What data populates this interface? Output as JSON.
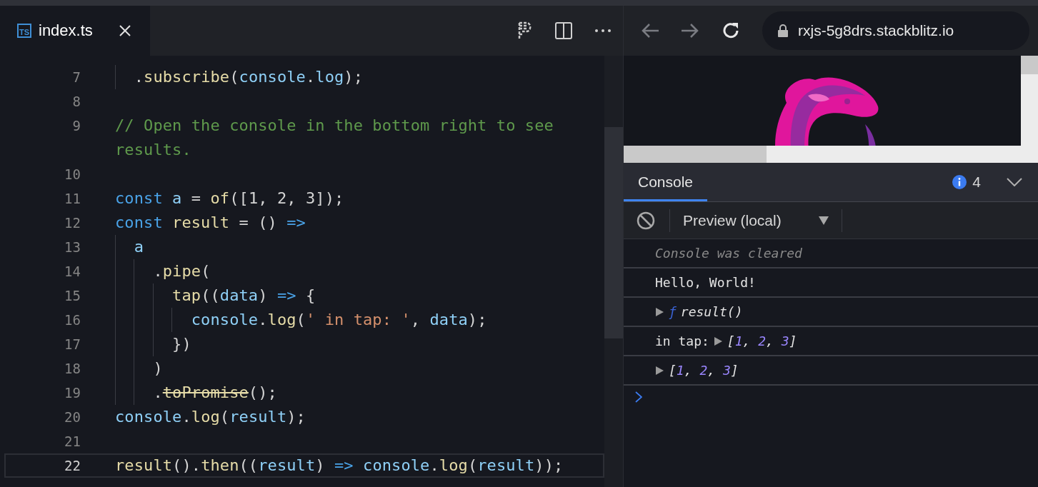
{
  "editor": {
    "tabs": [
      {
        "file_icon": "TS",
        "label": "index.ts",
        "selected": true
      }
    ],
    "lines": [
      {
        "number": "7",
        "current": false,
        "tokens": [
          {
            "kind": "plain",
            "text": "  ."
          },
          {
            "kind": "fn",
            "text": "subscribe"
          },
          {
            "kind": "plain",
            "text": "("
          },
          {
            "kind": "var",
            "text": "console"
          },
          {
            "kind": "plain",
            "text": "."
          },
          {
            "kind": "var",
            "text": "log"
          },
          {
            "kind": "plain",
            "text": ");"
          }
        ]
      },
      {
        "number": "8",
        "current": false
      },
      {
        "number": "9",
        "current": false,
        "tokens": [
          {
            "kind": "comment",
            "text": "// Open the console in the bottom right to see results."
          }
        ]
      },
      {
        "number": "10",
        "current": false
      },
      {
        "number": "11",
        "current": false,
        "tokens": [
          {
            "kind": "keyword",
            "text": "const "
          },
          {
            "kind": "var",
            "text": "a"
          },
          {
            "kind": "plain",
            "text": " = "
          },
          {
            "kind": "fn",
            "text": "of"
          },
          {
            "kind": "plain",
            "text": "([1, 2, 3]);"
          }
        ]
      },
      {
        "number": "12",
        "current": false,
        "tokens": [
          {
            "kind": "keyword",
            "text": "const "
          },
          {
            "kind": "fn",
            "text": "result"
          },
          {
            "kind": "plain",
            "text": " = () "
          },
          {
            "kind": "keyword",
            "text": "=>"
          }
        ]
      },
      {
        "number": "13",
        "current": false,
        "tokens": [
          {
            "kind": "var",
            "text": "  a"
          }
        ]
      },
      {
        "number": "14",
        "current": false,
        "tokens": [
          {
            "kind": "plain",
            "text": "    ."
          },
          {
            "kind": "fn",
            "text": "pipe"
          },
          {
            "kind": "plain",
            "text": "("
          }
        ]
      },
      {
        "number": "15",
        "current": false,
        "tokens": [
          {
            "kind": "fn",
            "text": "      tap"
          },
          {
            "kind": "plain",
            "text": "(("
          },
          {
            "kind": "var",
            "text": "data"
          },
          {
            "kind": "plain",
            "text": ") "
          },
          {
            "kind": "keyword",
            "text": "=>"
          },
          {
            "kind": "plain",
            "text": " {"
          }
        ]
      },
      {
        "number": "16",
        "current": false,
        "tokens": [
          {
            "kind": "var",
            "text": "        console"
          },
          {
            "kind": "plain",
            "text": "."
          },
          {
            "kind": "fn",
            "text": "log"
          },
          {
            "kind": "plain",
            "text": "("
          },
          {
            "kind": "string",
            "text": "' in tap: '"
          },
          {
            "kind": "plain",
            "text": ", "
          },
          {
            "kind": "var",
            "text": "data"
          },
          {
            "kind": "plain",
            "text": ");"
          }
        ]
      },
      {
        "number": "17",
        "current": false,
        "tokens": [
          {
            "kind": "plain",
            "text": "      })"
          }
        ]
      },
      {
        "number": "18",
        "current": false,
        "tokens": [
          {
            "kind": "plain",
            "text": "    )"
          }
        ]
      },
      {
        "number": "19",
        "current": false,
        "tokens": [
          {
            "kind": "plain",
            "text": "    ."
          },
          {
            "kind": "deprecated",
            "text": "toPromise"
          },
          {
            "kind": "plain",
            "text": "();"
          }
        ]
      },
      {
        "number": "20",
        "current": false,
        "tokens": [
          {
            "kind": "var",
            "text": "console"
          },
          {
            "kind": "plain",
            "text": "."
          },
          {
            "kind": "fn",
            "text": "log"
          },
          {
            "kind": "plain",
            "text": "("
          },
          {
            "kind": "var",
            "text": "result"
          },
          {
            "kind": "plain",
            "text": ");"
          }
        ]
      },
      {
        "number": "21",
        "current": false
      },
      {
        "number": "22",
        "current": true,
        "tokens": [
          {
            "kind": "fn",
            "text": "result"
          },
          {
            "kind": "plain",
            "text": "()."
          },
          {
            "kind": "fn",
            "text": "then"
          },
          {
            "kind": "plain",
            "text": "(("
          },
          {
            "kind": "var",
            "text": "result"
          },
          {
            "kind": "plain",
            "text": ") "
          },
          {
            "kind": "keyword",
            "text": "=> "
          },
          {
            "kind": "var",
            "text": "console"
          },
          {
            "kind": "plain",
            "text": "."
          },
          {
            "kind": "fn",
            "text": "log"
          },
          {
            "kind": "plain",
            "text": "("
          },
          {
            "kind": "var",
            "text": "result"
          },
          {
            "kind": "plain",
            "text": "));"
          }
        ]
      }
    ]
  },
  "browser": {
    "url": "rxjs-5g8drs.stackblitz.io"
  },
  "console": {
    "tabs": [
      {
        "label": "Console",
        "selected": true
      }
    ],
    "info_count": "4",
    "context": "Preview (local)",
    "messages": [
      {
        "kind": "cleared",
        "text": "Console was cleared"
      },
      {
        "kind": "text",
        "text": "Hello, World!"
      },
      {
        "kind": "function",
        "prefix": "ƒ",
        "text": "result()"
      },
      {
        "kind": "array",
        "label": "in tap:",
        "value": [
          {
            "kind": "punct",
            "text": "["
          },
          {
            "kind": "num",
            "text": "1"
          },
          {
            "kind": "punct",
            "text": ", "
          },
          {
            "kind": "num",
            "text": "2"
          },
          {
            "kind": "punct",
            "text": ", "
          },
          {
            "kind": "num",
            "text": "3"
          },
          {
            "kind": "punct",
            "text": "]"
          }
        ]
      },
      {
        "kind": "array",
        "value": [
          {
            "kind": "punct",
            "text": "["
          },
          {
            "kind": "num",
            "text": "1"
          },
          {
            "kind": "punct",
            "text": ", "
          },
          {
            "kind": "num",
            "text": "2"
          },
          {
            "kind": "punct",
            "text": ", "
          },
          {
            "kind": "num",
            "text": "3"
          },
          {
            "kind": "punct",
            "text": "]"
          }
        ]
      }
    ]
  }
}
